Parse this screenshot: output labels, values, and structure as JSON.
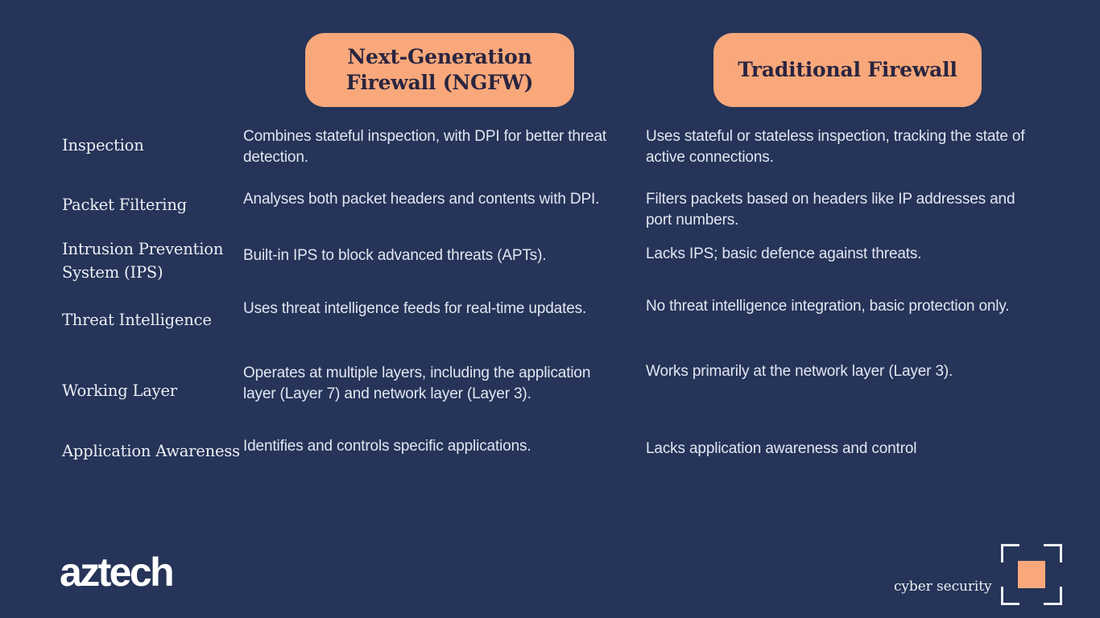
{
  "theme": {
    "background_color": "#253458",
    "accent_color": "#F9A87B",
    "text_color": "#E2E6F2",
    "header_text_color": "#2A2540"
  },
  "headers": {
    "column_a_line1": "Next-Generation",
    "column_a_line2": "Firewall (NGFW)",
    "column_b": "Traditional Firewall"
  },
  "rows": [
    {
      "label": "Inspection",
      "ngfw": "Combines stateful inspection, with DPI for better threat detection.",
      "traditional": "Uses stateful or stateless inspection, tracking the state of active connections."
    },
    {
      "label": "Packet Filtering",
      "ngfw": "Analyses both packet headers and contents with DPI.",
      "traditional": "Filters packets based on headers like IP addresses and port numbers."
    },
    {
      "label": "Intrusion Prevention System (IPS)",
      "ngfw": "Built-in IPS to block advanced threats (APTs).",
      "traditional": "Lacks IPS; basic defence against threats."
    },
    {
      "label": "Threat Intelligence",
      "ngfw": "Uses threat intelligence feeds for real-time updates.",
      "traditional": "No threat intelligence integration, basic protection only."
    },
    {
      "label": "Working Layer",
      "ngfw": "Operates at multiple layers, including the application layer (Layer 7) and network layer (Layer 3).",
      "traditional": "Works primarily at the network layer (Layer 3)."
    },
    {
      "label": "Application Awareness",
      "ngfw": "Identifies and controls specific applications.",
      "traditional": "Lacks application awareness and control"
    }
  ],
  "footer": {
    "logo_text": "aztech",
    "badge_label": "cyber security",
    "badge_icon": "crop-frame-icon"
  }
}
